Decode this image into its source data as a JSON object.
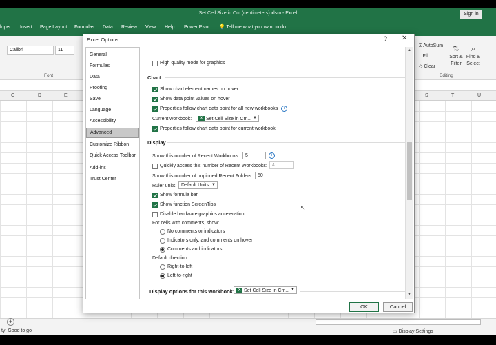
{
  "excel": {
    "doc_title": "Set Cell Size in Cm (centimeters).xlsm  -  Excel",
    "sign_in": "Sign in",
    "tabs": [
      "loper",
      "Insert",
      "Page Layout",
      "Formulas",
      "Data",
      "Review",
      "View",
      "Help",
      "Power Pivot"
    ],
    "tell_me": "Tell me what you want to do",
    "font_name": "Calibri",
    "font_size": "11",
    "font_group": "Font",
    "autosum": "AutoSum",
    "fill": "Fill",
    "clear": "Clear",
    "sort_filter": "Sort & Filter",
    "find_select": "Find & Select",
    "editing_group": "Editing",
    "columns": [
      "C",
      "D",
      "E",
      "S",
      "T",
      "U"
    ],
    "status": "ty: Good to go",
    "display_settings": "Display Settings"
  },
  "dialog": {
    "title": "Excel Options",
    "help": "?",
    "close": "✕",
    "nav": [
      "General",
      "Formulas",
      "Data",
      "Proofing",
      "Save",
      "Language",
      "Accessibility",
      "Advanced",
      "Customize Ribbon",
      "Quick Access Toolbar",
      "Add-ins",
      "Trust Center"
    ],
    "selected_nav": "Advanced",
    "high_quality": "High quality mode for graphics",
    "chart": {
      "heading": "Chart",
      "names_hover": "Show chart element names on hover",
      "values_hover": "Show data point values on hover",
      "props_all": "Properties follow chart data point for all new workbooks",
      "current_wb_label": "Current workbook:",
      "current_wb_value": "Set Cell Size in Cm...",
      "props_current": "Properties follow chart data point for current workbook"
    },
    "display": {
      "heading": "Display",
      "recent_label": "Show this number of Recent Workbooks:",
      "recent_value": "5",
      "quick_access": "Quickly access this number of Recent Workbooks:",
      "quick_value": "4",
      "unpinned_label": "Show this number of unpinned Recent Folders:",
      "unpinned_value": "50",
      "ruler_label": "Ruler units",
      "ruler_value": "Default Units",
      "formula_bar": "Show formula bar",
      "screentips": "Show function ScreenTips",
      "disable_hw": "Disable hardware graphics acceleration",
      "comments_label": "For cells with comments, show:",
      "no_comments": "No comments or indicators",
      "indicators_only": "Indicators only, and comments on hover",
      "comments_and": "Comments and indicators",
      "direction_label": "Default direction:",
      "rtl": "Right-to-left",
      "ltr": "Left-to-right",
      "wb_display_label": "Display options for this workbook:",
      "wb_display_value": "Set Cell Size in Cm..."
    },
    "ok": "OK",
    "cancel": "Cancel"
  }
}
